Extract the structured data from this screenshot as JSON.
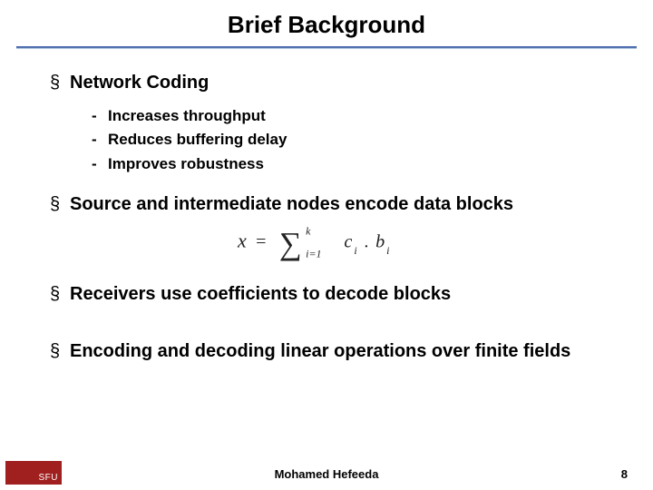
{
  "title": "Brief Background",
  "points": {
    "p1": {
      "heading": "Network Coding",
      "subs": [
        "Increases throughput",
        "Reduces buffering delay",
        "Improves robustness"
      ]
    },
    "p2": "Source and intermediate nodes encode data blocks",
    "p3": "Receivers use coefficients to decode blocks",
    "p4": "Encoding and decoding linear operations over finite fields"
  },
  "formula": {
    "latex": "x = \\sum_{i=1}^{k} c_i . b_i",
    "lhs": "x",
    "sum_lower": "i=1",
    "sum_upper": "k",
    "term1": "c",
    "term2": "b",
    "sub": "i"
  },
  "footer": {
    "author": "Mohamed  Hefeeda",
    "page": "8",
    "logo": "SFU"
  }
}
